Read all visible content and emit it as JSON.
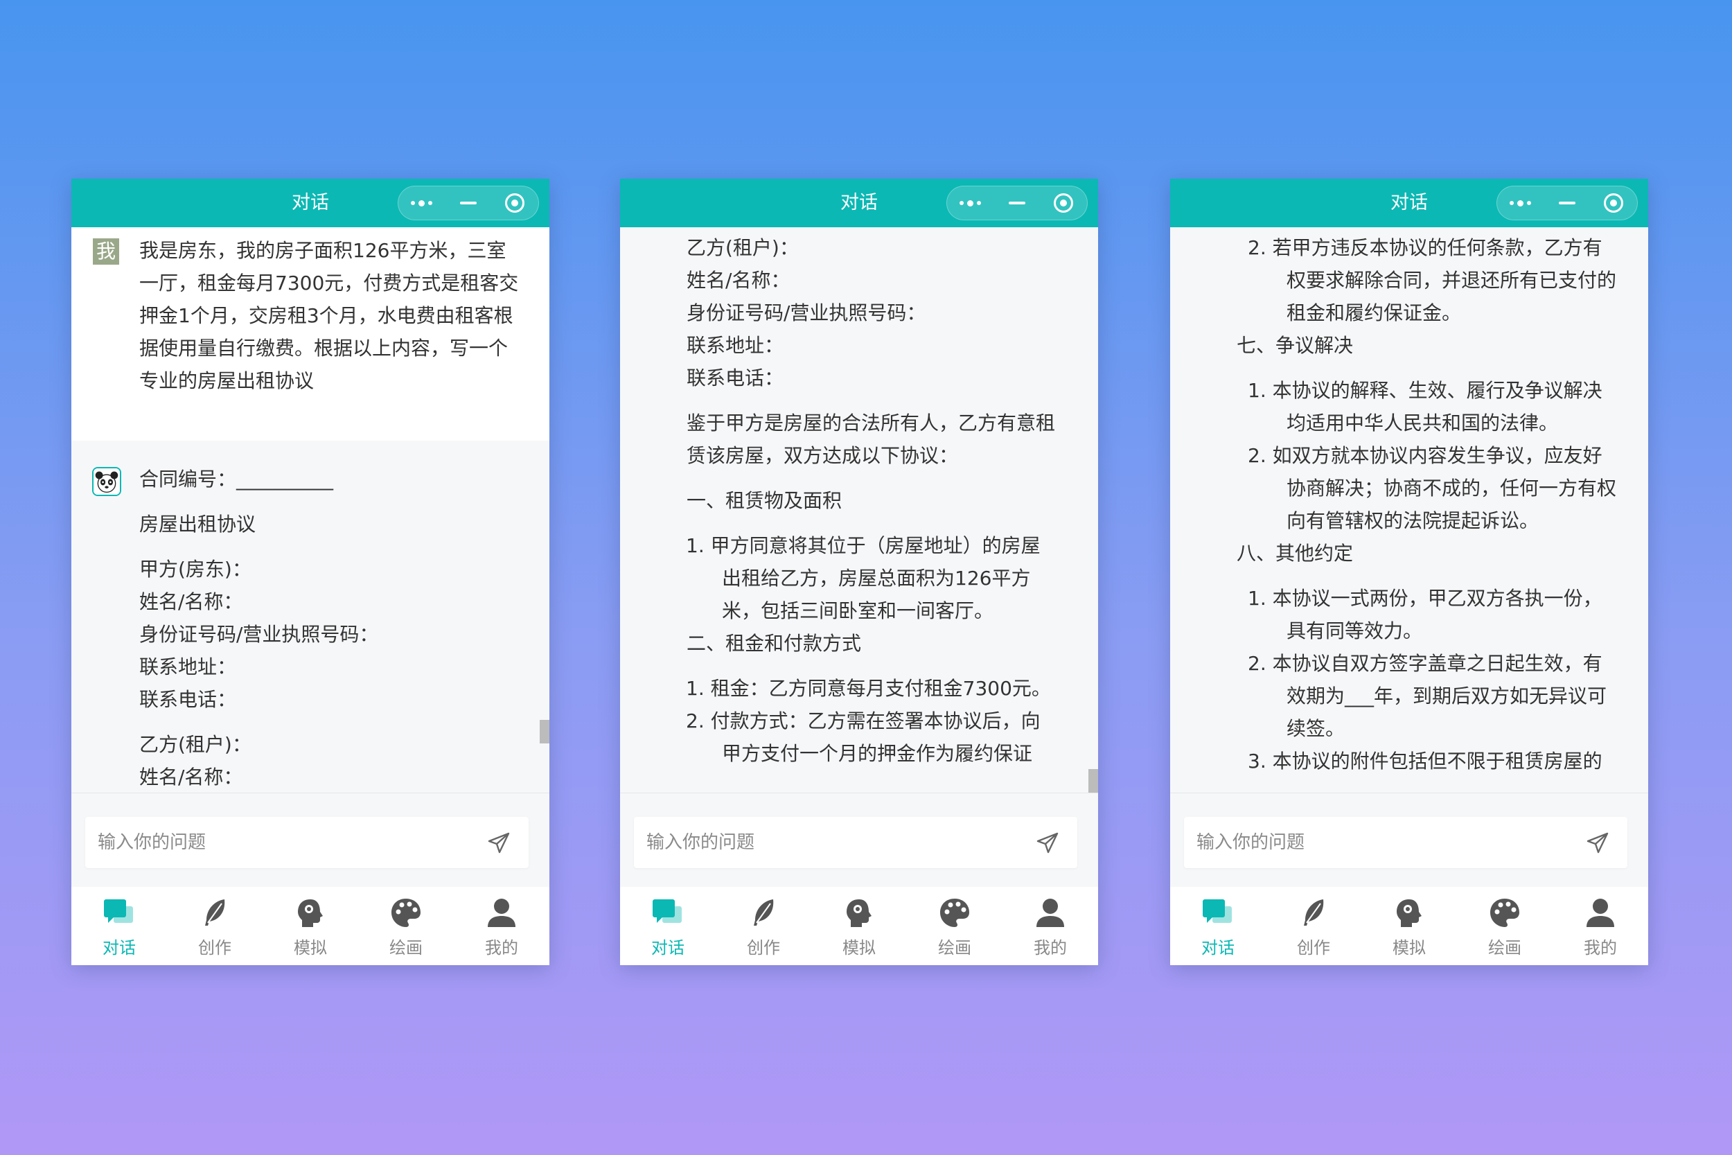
{
  "app": {
    "window_title": "对话",
    "capsule": {
      "more_icon": "more-dots-icon",
      "minimize_icon": "minimize-icon",
      "close_icon": "close-target-icon"
    },
    "input": {
      "placeholder": "输入你的问题",
      "send_icon": "send-plane-icon"
    },
    "tabs": [
      {
        "label": "对话",
        "icon": "chat-bubbles-icon",
        "active": true
      },
      {
        "label": "创作",
        "icon": "feather-icon",
        "active": false
      },
      {
        "label": "模拟",
        "icon": "head-profile-icon",
        "active": false
      },
      {
        "label": "绘画",
        "icon": "palette-icon",
        "active": false
      },
      {
        "label": "我的",
        "icon": "user-icon",
        "active": false
      }
    ],
    "colors": {
      "accent": "#0bb8b4",
      "text": "#333333",
      "tab_inactive": "#888888"
    }
  },
  "screens": [
    {
      "user_message": {
        "avatar_text": "我",
        "lines": [
          "我是房东，我的房子面积126平方米，三室",
          "一厅，租金每月7300元，付费方式是租客交",
          "押金1个月，交房租3个月，水电费由租客根",
          "据使用量自行缴费。根据以上内容，写一个",
          "专业的房屋出租协议"
        ]
      },
      "ai_message": {
        "contract_no": "合同编号：__________",
        "title": "房屋出租协议",
        "party_a": [
          "甲方(房东)：",
          "姓名/名称：",
          "身份证号码/营业执照号码：",
          "联系地址：",
          "联系电话："
        ],
        "party_b": [
          "乙方(租户)：",
          "姓名/名称："
        ]
      }
    },
    {
      "party_b": [
        "乙方(租户)：",
        "姓名/名称：",
        "身份证号码/营业执照号码：",
        "联系地址：",
        "联系电话："
      ],
      "preamble": [
        "鉴于甲方是房屋的合法所有人，乙方有意租",
        "赁该房屋，双方达成以下协议："
      ],
      "section1": {
        "heading": "一、租赁物及面积",
        "items": [
          {
            "num": "1.",
            "lines": [
              "甲方同意将其位于（房屋地址）的房屋",
              "出租给乙方，房屋总面积为126平方",
              "米，包括三间卧室和一间客厅。"
            ]
          }
        ]
      },
      "section2": {
        "heading": "二、租金和付款方式",
        "items": [
          {
            "num": "1.",
            "lines": [
              "租金：乙方同意每月支付租金7300元。"
            ]
          },
          {
            "num": "2.",
            "lines": [
              "付款方式：乙方需在签署本协议后，向",
              "甲方支付一个月的押金作为履约保证"
            ]
          }
        ]
      }
    },
    {
      "top_items": [
        {
          "num": "2.",
          "lines": [
            "若甲方违反本协议的任何条款，乙方有",
            "权要求解除合同，并退还所有已支付的",
            "租金和履约保证金。"
          ]
        }
      ],
      "section7": {
        "heading": "七、争议解决",
        "items": [
          {
            "num": "1.",
            "lines": [
              "本协议的解释、生效、履行及争议解决",
              "均适用中华人民共和国的法律。"
            ]
          },
          {
            "num": "2.",
            "lines": [
              "如双方就本协议内容发生争议，应友好",
              "协商解决；协商不成的，任何一方有权",
              "向有管辖权的法院提起诉讼。"
            ]
          }
        ]
      },
      "section8": {
        "heading": "八、其他约定",
        "items": [
          {
            "num": "1.",
            "lines": [
              "本协议一式两份，甲乙双方各执一份，",
              "具有同等效力。"
            ]
          },
          {
            "num": "2.",
            "lines": [
              "本协议自双方签字盖章之日起生效，有",
              "效期为___年，到期后双方如无异议可",
              "续签。"
            ]
          },
          {
            "num": "3.",
            "lines": [
              "本协议的附件包括但不限于租赁房屋的"
            ]
          }
        ]
      }
    }
  ]
}
